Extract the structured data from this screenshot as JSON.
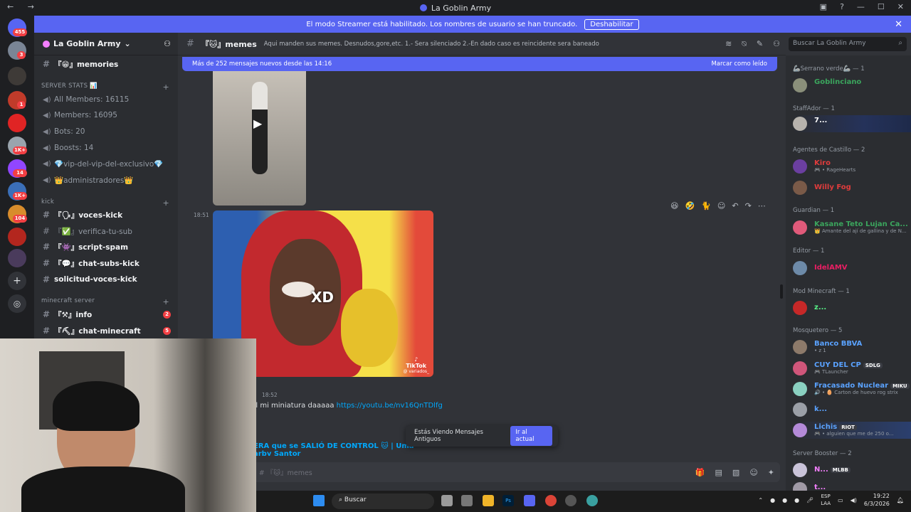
{
  "window": {
    "title": "La Goblin Army",
    "nav": "← →",
    "controls": [
      "▣",
      "?",
      "—",
      "☐",
      "✕"
    ]
  },
  "banner": {
    "text": "El modo Streamer está habilitado. Los nombres de usuario se han truncado.",
    "button": "Deshabilitar",
    "close": "✕"
  },
  "servers": {
    "badges": [
      "455",
      "3",
      "1",
      "1K+",
      "14",
      "1K+",
      "104"
    ]
  },
  "sidebar": {
    "server_name": "La Goblin Army",
    "channels": [
      {
        "label": "『😁』memories",
        "bold": true
      },
      {
        "category": "SERVER STATS 📊"
      },
      {
        "label": "All Members: 16115",
        "voice": true
      },
      {
        "label": "Members: 16095",
        "voice": true
      },
      {
        "label": "Bots: 20",
        "voice": true
      },
      {
        "label": "Boosts: 14",
        "voice": true
      },
      {
        "label": "💎vip-del-vip-del-exclusivo💎",
        "voice": true
      },
      {
        "label": "👑administradores👑",
        "voice": true
      },
      {
        "category": "kick"
      },
      {
        "label": "『🗣』voces-kick",
        "bold": true
      },
      {
        "label": "『✅』verifica-tu-sub",
        "bold": false
      },
      {
        "label": "『👾』script-spam",
        "bold": true
      },
      {
        "label": "『💬』chat-subs-kick",
        "bold": true
      },
      {
        "label": "solicitud-voces-kick",
        "bold": true
      },
      {
        "category": "minecraft server"
      },
      {
        "label": "『⚒』info",
        "bold": true,
        "count": "2"
      },
      {
        "label": "『⛏』chat-minecraft",
        "bold": true,
        "count": "5"
      }
    ]
  },
  "chat": {
    "channel_name": "『🐱』memes",
    "topic": "Aqui manden sus memes. Desnudos,gore,etc. 1.- Sera silenciado 2.-En dado caso es reincidente sera baneado",
    "search_placeholder": "Buscar La Goblin Army",
    "new_messages": "Más de 252 mensajes nuevos desde las 14:16",
    "mark_read": "Marcar como leído",
    "msg_time": "18:51",
    "video_caption": "XD",
    "tiktok_label": "TikTok",
    "tiktok_user": "@ variados_",
    "msg2_time": "18:52",
    "msg2_text": "e tal mi miniatura daaaaa",
    "msg2_link": "https://youtu.be/nv16QnTDlfg",
    "embed_title": "ERA que se SALIÓ DE CONTROL 🐱 | Uma",
    "embed_title2": "arby Santor",
    "toast_text": "Estás Viendo Mensajes Antiguos",
    "toast_button": "Ir al actual",
    "composer_placeholder": "e a # 『🐱』memes"
  },
  "members": {
    "roles": [
      {
        "label": "🦾Serrano verde🦾 — 1"
      },
      {
        "label": "StaffAdor — 1"
      },
      {
        "label": "Agentes de Castillo — 2"
      },
      {
        "label": "Guardian — 1"
      },
      {
        "label": "Editor — 1"
      },
      {
        "label": "Mod Minecraft — 1"
      },
      {
        "label": "Mosquetero — 5"
      },
      {
        "label": "Server Booster — 2"
      }
    ],
    "list": [
      {
        "name": "Goblinciano",
        "status": "",
        "color": "#3ba55d"
      },
      {
        "name": "7...",
        "status": "",
        "color": "#ffffff"
      },
      {
        "name": "Kiro",
        "status": "🎮 • RageHearts",
        "color": "#e03c3c"
      },
      {
        "name": "Willy Fog",
        "status": "",
        "color": "#e03c3c"
      },
      {
        "name": "Kasane Teto Lujan Ca...",
        "status": "👑 Amante del ají de gallina y de N...",
        "color": "#3ba55d"
      },
      {
        "name": "IdelAMV",
        "status": "",
        "color": "#e91e63"
      },
      {
        "name": "z...",
        "status": "",
        "color": "#57f287"
      },
      {
        "name": "Banco BBVA",
        "status": "• z 1",
        "color": "#5aa2ff"
      },
      {
        "name": "CUY DEL CP",
        "status": "🎮 TLauncher",
        "color": "#5aa2ff",
        "tag": "SDLG"
      },
      {
        "name": "Fracasado Nuclear",
        "status": "🔊 • 🥚 Carton de huevo rog strix",
        "color": "#5aa2ff",
        "tag": "MIKU"
      },
      {
        "name": "k...",
        "status": "",
        "color": "#5aa2ff"
      },
      {
        "name": "Lichis",
        "status": "🎮 • alguien que me de 250 o...",
        "color": "#5aa2ff",
        "tag": "RIOT"
      },
      {
        "name": "N...",
        "status": "",
        "color": "#f47fff",
        "tag": "MLBB"
      },
      {
        "name": "t...",
        "status": "",
        "color": "#f47fff"
      }
    ]
  },
  "taskbar": {
    "search": "Buscar",
    "lang1": "ESP",
    "lang2": "LAA",
    "time": "19:22",
    "date": "6/3/2026"
  },
  "colors": {
    "accent": "#5865f2",
    "bg": "#313338",
    "sidebar": "#2b2d31",
    "server_rail": "#1e1f22"
  }
}
